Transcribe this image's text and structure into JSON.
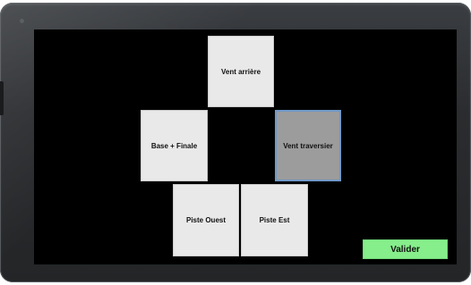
{
  "buttons": {
    "downwind": {
      "label": "Vent arrière"
    },
    "base_final": {
      "label": "Base + Finale"
    },
    "crosswind": {
      "label": "Vent traversier",
      "selected": true
    },
    "runway_west": {
      "label": "Piste Ouest"
    },
    "runway_east": {
      "label": "Piste Est"
    },
    "validate": {
      "label": "Valider"
    }
  },
  "colors": {
    "screen_background": "#000000",
    "tile_background": "#e9e9e9",
    "selected_tile_background": "#9c9c9c",
    "selected_tile_border": "#6f98c7",
    "validate_background": "#86ee8b"
  }
}
